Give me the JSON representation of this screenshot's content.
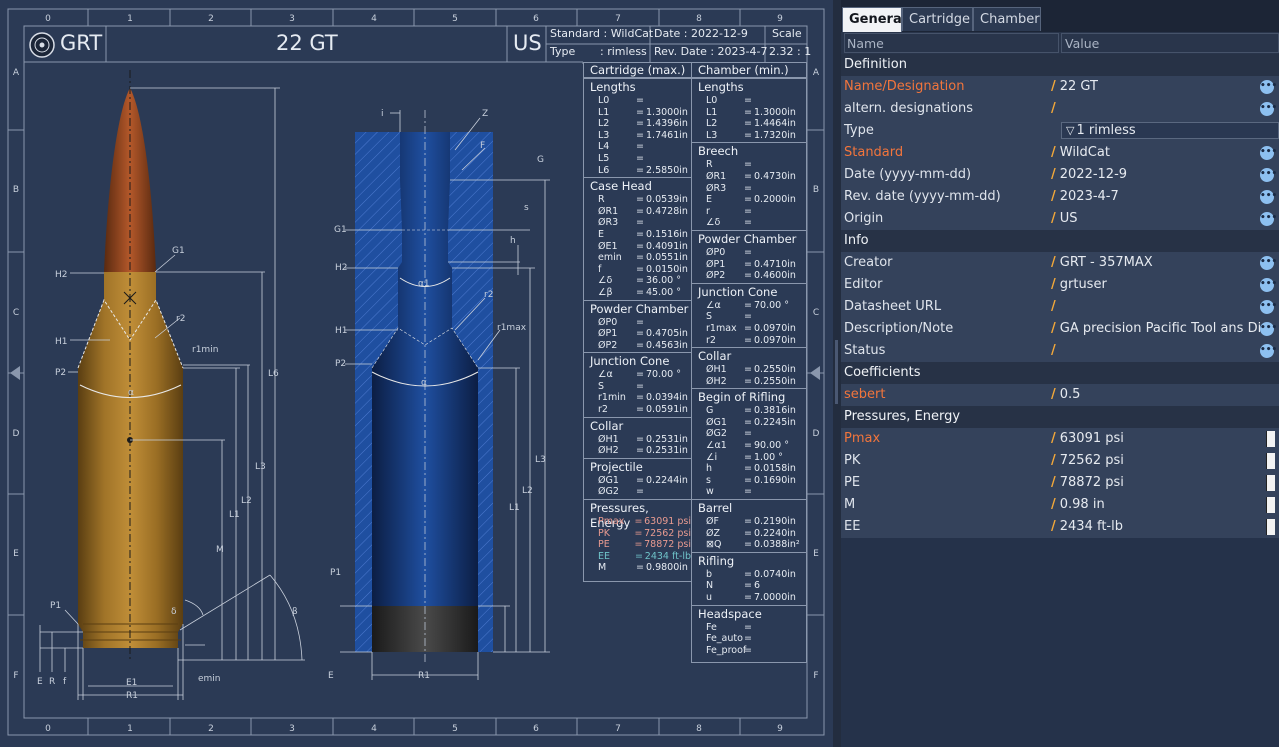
{
  "title_block": {
    "logo_text": "GRT",
    "cartridge_name": "22 GT",
    "origin": "US",
    "standard_line": "Standard : WildCat",
    "type_label": "Type",
    "type_value": ": rimless",
    "date_line": "Date       : 2022-12-9",
    "rev_date_line": "Rev. Date : 2023-4-7",
    "scale_label": "Scale",
    "scale_value": "2.32 : 1"
  },
  "border": {
    "columns": [
      "0",
      "1",
      "2",
      "3",
      "4",
      "5",
      "6",
      "7",
      "8",
      "9"
    ],
    "rows": [
      "A",
      "B",
      "C",
      "D",
      "E",
      "F"
    ]
  },
  "dim_labels": {
    "cart": {
      "G1": "G1",
      "H2": "H2",
      "r2": "r2",
      "H1": "H1",
      "r1min": "r1min",
      "P2": "P2",
      "alpha": "α",
      "L6": "L6",
      "L3": "L3",
      "L2": "L2",
      "L1": "L1",
      "M": "M",
      "P1": "P1",
      "delta": "δ",
      "beta": "β",
      "E": "E",
      "R": "R",
      "f": "f",
      "E1": "E1",
      "R1": "R1",
      "emin": "emin"
    },
    "chamber": {
      "i": "i",
      "Z": "Z",
      "F": "F",
      "G": "G",
      "G1": "G1",
      "s": "s",
      "h": "h",
      "H2": "H2",
      "alpha1": "α1",
      "r2": "r2",
      "H1": "H1",
      "r1max": "r1max",
      "P2": "P2",
      "alpha": "α",
      "L3": "L3",
      "L2": "L2",
      "L1": "L1",
      "P1": "P1",
      "E": "E",
      "R1": "R1"
    }
  },
  "cartridge_table": {
    "header": "Cartridge (max.)",
    "sections": [
      {
        "title": "Lengths",
        "rows": [
          [
            "L0",
            "=",
            ""
          ],
          [
            "L1",
            "=",
            "1.3000in"
          ],
          [
            "L2",
            "=",
            "1.4396in"
          ],
          [
            "L3",
            "=",
            "1.7461in"
          ],
          [
            "L4",
            "=",
            ""
          ],
          [
            "L5",
            "=",
            ""
          ],
          [
            "L6",
            "=",
            "2.5850in"
          ]
        ]
      },
      {
        "title": "Case Head",
        "rows": [
          [
            "R",
            "=",
            "0.0539in"
          ],
          [
            "ØR1",
            "=",
            "0.4728in"
          ],
          [
            "ØR3",
            "=",
            ""
          ],
          [
            "E",
            "=",
            "0.1516in"
          ],
          [
            "ØE1",
            "=",
            "0.4091in"
          ],
          [
            "emin",
            "=",
            "0.0551in"
          ],
          [
            "f",
            "=",
            "0.0150in"
          ],
          [
            "∠δ",
            "=",
            "36.00 °"
          ],
          [
            "∠β",
            "=",
            "45.00 °"
          ]
        ]
      },
      {
        "title": "Powder Chamber",
        "rows": [
          [
            "ØP0",
            "=",
            ""
          ],
          [
            "ØP1",
            "=",
            "0.4705in"
          ],
          [
            "ØP2",
            "=",
            "0.4563in"
          ]
        ]
      },
      {
        "title": "Junction Cone",
        "rows": [
          [
            "∠α",
            "=",
            "70.00 °"
          ],
          [
            "S",
            "=",
            ""
          ],
          [
            "r1min",
            "=",
            "0.0394in"
          ],
          [
            "r2",
            "=",
            "0.0591in"
          ]
        ]
      },
      {
        "title": "Collar",
        "rows": [
          [
            "ØH1",
            "=",
            "0.2531in"
          ],
          [
            "ØH2",
            "=",
            "0.2531in"
          ]
        ]
      },
      {
        "title": "Projectile",
        "rows": [
          [
            "ØG1",
            "=",
            "0.2244in"
          ],
          [
            "ØG2",
            "=",
            ""
          ]
        ]
      },
      {
        "title": "Pressures, Energy",
        "rows": [
          [
            "Pmax",
            "=",
            "63091 psi",
            "pink"
          ],
          [
            "PK",
            "=",
            "72562 psi",
            "pink"
          ],
          [
            "PE",
            "=",
            "78872 psi",
            "pink"
          ],
          [
            "EE",
            "=",
            "2434   ft-lb",
            "cyan"
          ],
          [
            "M",
            "=",
            "0.9800in",
            ""
          ]
        ]
      }
    ]
  },
  "chamber_table": {
    "header": "Chamber (min.)",
    "sections": [
      {
        "title": "Lengths",
        "rows": [
          [
            "L0",
            "=",
            ""
          ],
          [
            "L1",
            "=",
            "1.3000in"
          ],
          [
            "L2",
            "=",
            "1.4464in"
          ],
          [
            "L3",
            "=",
            "1.7320in"
          ]
        ]
      },
      {
        "title": "Breech",
        "rows": [
          [
            "R",
            "=",
            ""
          ],
          [
            "ØR1",
            "=",
            "0.4730in"
          ],
          [
            "ØR3",
            "=",
            ""
          ],
          [
            "E",
            "=",
            "0.2000in"
          ],
          [
            "r",
            "=",
            ""
          ],
          [
            "∠δ",
            "=",
            ""
          ]
        ]
      },
      {
        "title": "Powder Chamber",
        "rows": [
          [
            "ØP0",
            "=",
            ""
          ],
          [
            "ØP1",
            "=",
            "0.4710in"
          ],
          [
            "ØP2",
            "=",
            "0.4600in"
          ]
        ]
      },
      {
        "title": "Junction Cone",
        "rows": [
          [
            "∠α",
            "=",
            "70.00 °"
          ],
          [
            "S",
            "=",
            ""
          ],
          [
            "r1max",
            "=",
            "0.0970in"
          ],
          [
            "r2",
            "=",
            "0.0970in"
          ]
        ]
      },
      {
        "title": "Collar",
        "rows": [
          [
            "ØH1",
            "=",
            "0.2550in"
          ],
          [
            "ØH2",
            "=",
            "0.2550in"
          ]
        ]
      },
      {
        "title": "Begin of Rifling",
        "rows": [
          [
            "G",
            "=",
            "0.3816in"
          ],
          [
            "ØG1",
            "=",
            "0.2245in"
          ],
          [
            "ØG2",
            "=",
            ""
          ],
          [
            "∠α1",
            "=",
            "90.00 °"
          ],
          [
            "∠i",
            "=",
            "1.00 °"
          ],
          [
            "h",
            "=",
            "0.0158in"
          ],
          [
            "s",
            "=",
            "0.1690in"
          ],
          [
            "w",
            "=",
            ""
          ]
        ]
      },
      {
        "title": "Barrel",
        "rows": [
          [
            "ØF",
            "=",
            "0.2190in"
          ],
          [
            "ØZ",
            "=",
            "0.2240in"
          ],
          [
            "⊠Q",
            "=",
            "0.0388in²"
          ]
        ]
      },
      {
        "title": "Rifling",
        "rows": [
          [
            "b",
            "=",
            "0.0740in"
          ],
          [
            "N",
            "=",
            "6"
          ],
          [
            "u",
            "=",
            "7.0000in"
          ]
        ]
      },
      {
        "title": "Headspace",
        "rows": [
          [
            "Fe",
            "=",
            ""
          ],
          [
            "Fe_auto",
            "=",
            ""
          ],
          [
            "Fe_proof",
            "=",
            ""
          ]
        ]
      }
    ]
  },
  "panel": {
    "tabs": [
      "General",
      "Cartridge",
      "Chamber"
    ],
    "active_tab": 0,
    "col_name": "Name",
    "col_value": "Value",
    "rows": [
      {
        "kind": "group",
        "name": "Definition"
      },
      {
        "kind": "item",
        "name": "Name/Designation",
        "red": true,
        "value": "22 GT",
        "btn": "dots"
      },
      {
        "kind": "item",
        "name": "altern. designations",
        "red": false,
        "value": "",
        "btn": "dots"
      },
      {
        "kind": "item",
        "name": "Type",
        "red": false,
        "value": "1 rimless",
        "btn": "dropdown"
      },
      {
        "kind": "item",
        "name": "Standard",
        "red": true,
        "value": "WildCat",
        "btn": "dots"
      },
      {
        "kind": "item",
        "name": "Date (yyyy-mm-dd)",
        "red": false,
        "value": "2022-12-9",
        "btn": "dots"
      },
      {
        "kind": "item",
        "name": "Rev. date (yyyy-mm-dd)",
        "red": false,
        "value": "2023-4-7",
        "btn": "dots"
      },
      {
        "kind": "item",
        "name": "Origin",
        "red": false,
        "value": "US",
        "btn": "dots"
      },
      {
        "kind": "group",
        "name": "Info"
      },
      {
        "kind": "item",
        "name": "Creator",
        "red": false,
        "value": "GRT - 357MAX",
        "btn": "dots"
      },
      {
        "kind": "item",
        "name": "Editor",
        "red": false,
        "value": "grtuser",
        "btn": "dots"
      },
      {
        "kind": "item",
        "name": "Datasheet URL",
        "red": false,
        "value": "",
        "btn": "dots"
      },
      {
        "kind": "item",
        "name": "Description/Note",
        "red": false,
        "value": "GA precision Pacific Tool ans Die Re",
        "btn": "dots"
      },
      {
        "kind": "item",
        "name": "Status",
        "red": false,
        "value": "",
        "btn": "dots"
      },
      {
        "kind": "group",
        "name": "Coefficients"
      },
      {
        "kind": "item",
        "name": "sebert",
        "red": true,
        "value": "0.5",
        "btn": "none"
      },
      {
        "kind": "group",
        "name": "Pressures, Energy"
      },
      {
        "kind": "item",
        "name": "Pmax",
        "red": true,
        "value": "63091 psi",
        "btn": "ruler"
      },
      {
        "kind": "item",
        "name": "PK",
        "red": false,
        "value": "72562 psi",
        "btn": "ruler"
      },
      {
        "kind": "item",
        "name": "PE",
        "red": false,
        "value": "78872 psi",
        "btn": "ruler"
      },
      {
        "kind": "item",
        "name": "M",
        "red": false,
        "value": "0.98 in",
        "btn": "ruler"
      },
      {
        "kind": "item",
        "name": "EE",
        "red": false,
        "value": "2434 ft-lb",
        "btn": "ruler"
      }
    ]
  },
  "colors": {
    "sheet_bg": "#2b3a55",
    "panel_bg": "#25324a",
    "accent_red": "#f2753c",
    "accent_orange": "#f2a83a",
    "chamber_blue": "#1f4fa0"
  }
}
